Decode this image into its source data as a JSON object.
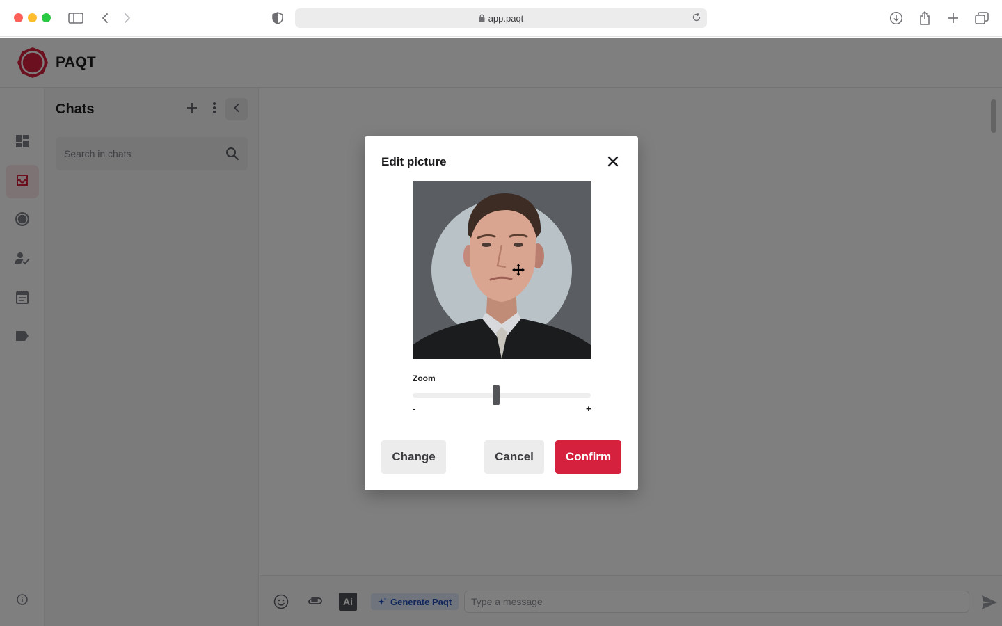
{
  "browser": {
    "url": "app.paqt",
    "icons": [
      "sidebar-icon",
      "back-icon",
      "forward-icon",
      "shield-icon",
      "lock-icon",
      "reload-icon",
      "download-icon",
      "share-icon",
      "new-tab-icon",
      "tabs-icon"
    ]
  },
  "app": {
    "brand": "PAQT",
    "accent_color": "#d5213d"
  },
  "rail": {
    "items": [
      {
        "icon": "dashboard-icon",
        "active": false
      },
      {
        "icon": "inbox-icon",
        "active": true
      },
      {
        "icon": "circle-icon",
        "active": false
      },
      {
        "icon": "user-check-icon",
        "active": false
      },
      {
        "icon": "calendar-icon",
        "active": false
      },
      {
        "icon": "tag-icon",
        "active": false
      }
    ],
    "footer_icon": "info-icon"
  },
  "chats": {
    "title": "Chats",
    "search_placeholder": "Search in chats"
  },
  "composer": {
    "ai_label": "Ai",
    "generate_label": "Generate Paqt",
    "message_placeholder": "Type a message"
  },
  "modal": {
    "title": "Edit picture",
    "zoom_label": "Zoom",
    "zoom_min_label": "-",
    "zoom_max_label": "+",
    "zoom_level": 0.47,
    "change_label": "Change",
    "cancel_label": "Cancel",
    "confirm_label": "Confirm"
  }
}
